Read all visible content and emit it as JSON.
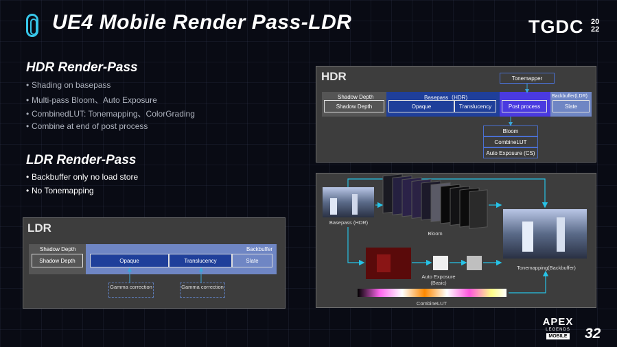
{
  "header": {
    "title": "UE4 Mobile Render Pass-LDR",
    "event_logo": "TGDC",
    "event_year_top": "20",
    "event_year_bottom": "22"
  },
  "hdr_section": {
    "title": "HDR Render-Pass",
    "bullets": [
      "Shading on basepass",
      "Multi-pass Bloom、Auto Exposure",
      "CombinedLUT: Tonemapping、ColorGrading",
      "Combine at end of post process"
    ]
  },
  "ldr_section": {
    "title": "LDR Render-Pass",
    "bullets": [
      "Backbuffer only no load store",
      "No Tonemapping"
    ]
  },
  "ldr_diagram": {
    "title": "LDR",
    "shadow_depth_header": "Shadow Depth",
    "shadow_depth_cell": "Shadow Depth",
    "backbuffer_header": "Backbuffer",
    "opaque": "Opaque",
    "translucency": "Translucency",
    "slate": "Slate",
    "gamma_1": "Gamma correction",
    "gamma_2": "Gamma correction"
  },
  "hdr_diagram": {
    "title": "HDR",
    "tonemapper": "Tonemapper",
    "shadow_depth_header": "Shadow Depth",
    "shadow_depth_cell": "Shadow Depth",
    "basepass_header": "Basepass（HDR)",
    "opaque": "Opaque",
    "translucency": "Translucency",
    "post_process": "Post process",
    "backbuffer_header": "Backbuffer(LDR)",
    "slate": "Slate",
    "bloom": "Bloom",
    "combine_lut": "CombineLUT",
    "auto_exposure": "Auto Exposure (CS)"
  },
  "flow_diagram": {
    "basepass": "Basepass (HDR)",
    "bloom": "Bloom",
    "auto_exposure": "Auto Exposure (Basic)",
    "tonemapping": "Tonemapping(Backbuffer)",
    "combine_lut": "CombineLUT"
  },
  "footer": {
    "page_number": "32",
    "brand_line1": "APEX",
    "brand_line2": "LEGENDS",
    "brand_line3": "MOBILE"
  },
  "colors": {
    "accent_cyan": "#37c7ea",
    "pass_blue": "#1f3f9a",
    "post_purple": "#4a3ae0",
    "slate_blue": "#6f86c4",
    "panel_gray": "#3d3d3d"
  }
}
